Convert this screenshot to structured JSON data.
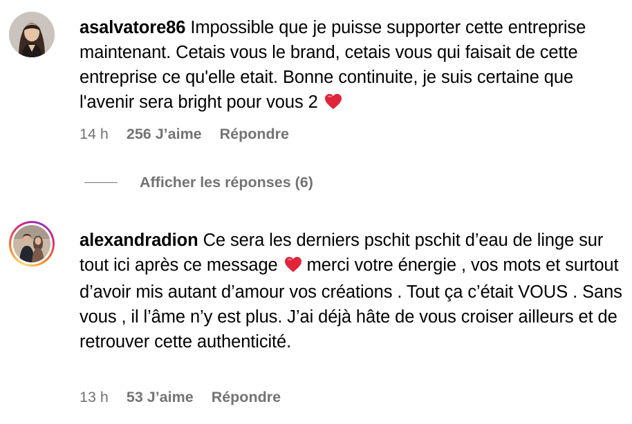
{
  "comments": [
    {
      "username": "asalvatore86",
      "text_before_heart": "Impossible que je puisse supporter cette entreprise maintenant. Cetais vous le brand, cetais vous qui faisait de cette entreprise ce qu'elle etait. Bonne continuite, je suis certaine que l'avenir sera bright pour vous 2",
      "text_after_heart": "",
      "time": "14 h",
      "likes": "256 J’aime",
      "reply_label": "Répondre",
      "avatar_story_ring": false
    },
    {
      "username": "alexandradion",
      "text_before_heart": "Ce sera les derniers pschit pschit d’eau de linge sur tout ici après ce message",
      "text_after_heart": "merci votre énergie , vos mots et surtout d’avoir mis autant d’amour vos créations . Tout ça c’était VOUS . Sans vous , il l’âme n’y est plus. J’ai déjà hâte de vous croiser ailleurs et de retrouver cette authenticité.",
      "time": "13 h",
      "likes": "53 J’aime",
      "reply_label": "Répondre",
      "avatar_story_ring": true
    }
  ],
  "replies_toggle": {
    "label": "Afficher les réponses (6)"
  },
  "icons": {
    "heart": "red-heart-emoji-icon"
  },
  "colors": {
    "text": "#000000",
    "secondary_text": "#737373",
    "heart": "#e0243a"
  }
}
